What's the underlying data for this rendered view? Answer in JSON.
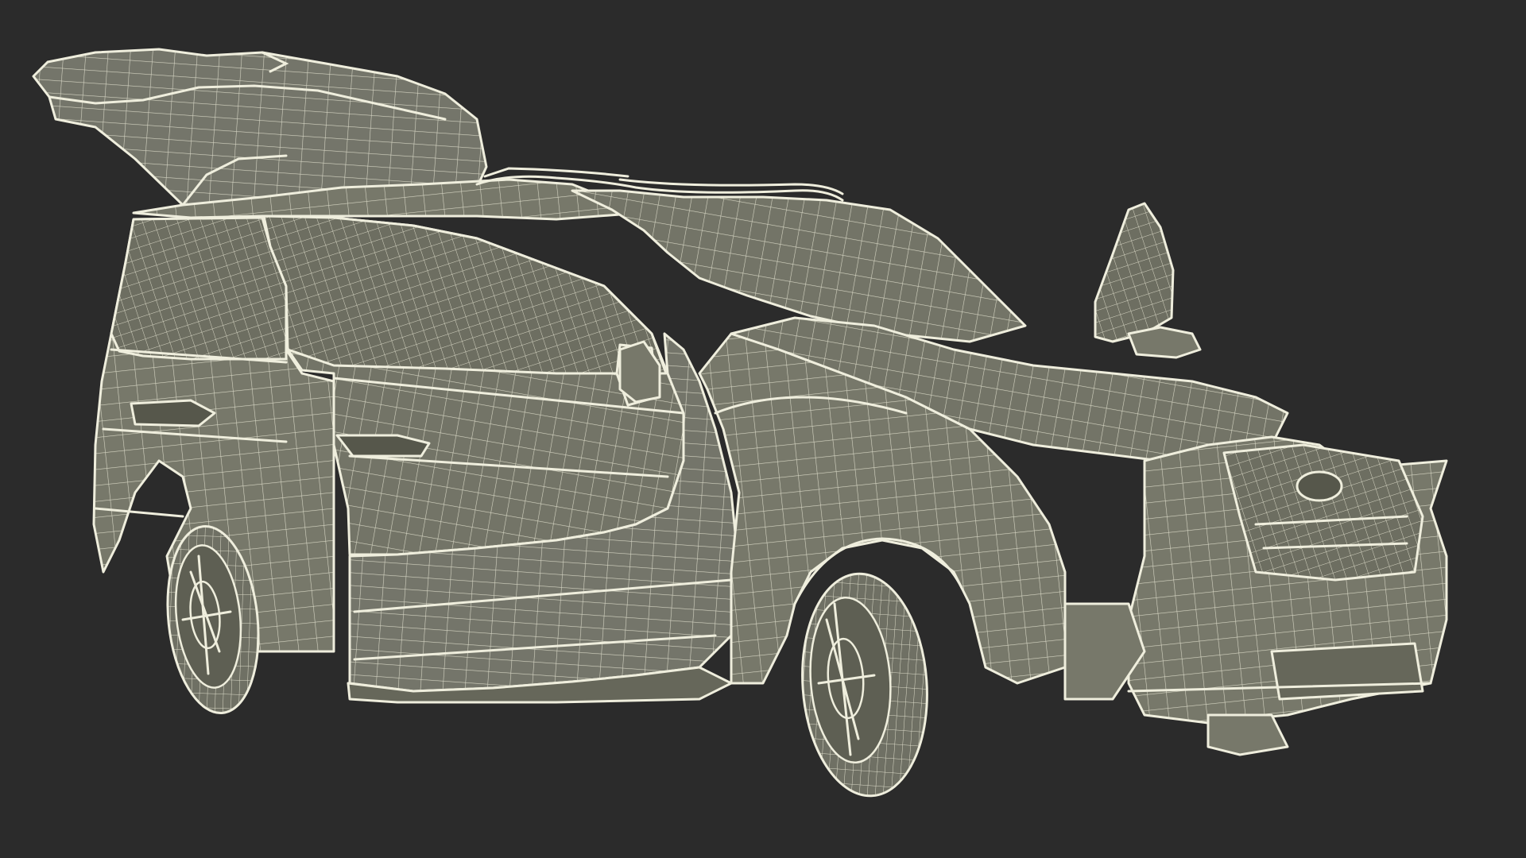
{
  "scene": {
    "subject": "vehicle-wireframe-model",
    "colors": {
      "background": "#2b2b2b",
      "surface": "#77786a",
      "wire": "#efeedd"
    }
  }
}
